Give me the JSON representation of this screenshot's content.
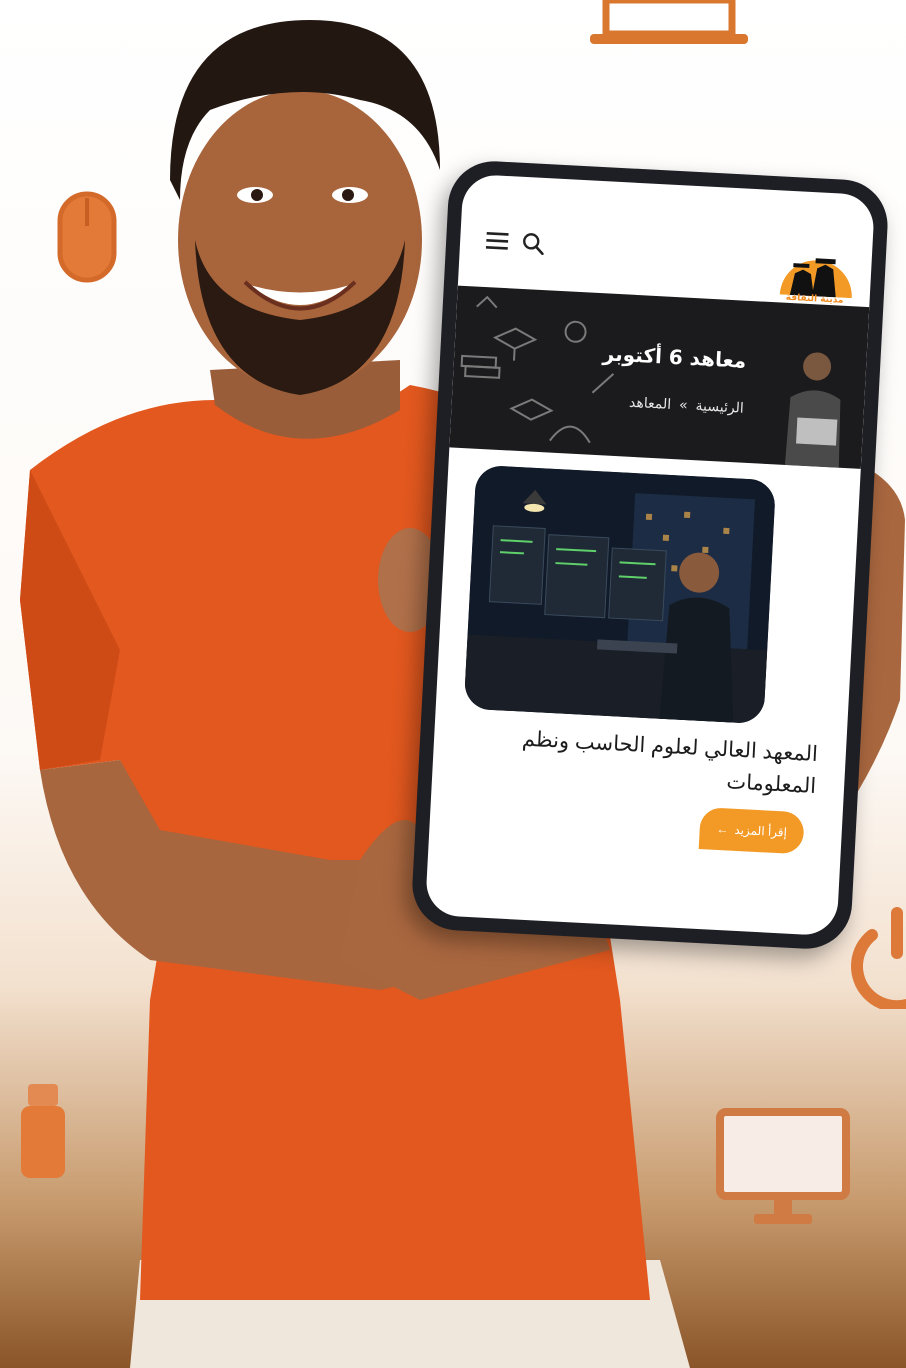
{
  "app": {
    "logo_text": "مدينة الثقافة والعلوم",
    "menu_icon": "hamburger-menu-icon",
    "search_icon": "search-icon"
  },
  "hero": {
    "title": "معاهد 6 أكتوبر",
    "breadcrumb": [
      "الرئيسية",
      "المعاهد"
    ],
    "separator": "»"
  },
  "card": {
    "title": "المعهد العالي لعلوم الحاسب ونظم المعلومات",
    "read_more_label": "إقرأ المزيد",
    "read_more_icon": "arrow-left-icon"
  },
  "colors": {
    "accent": "#f39a26",
    "shirt": "#e2581f",
    "hero_bg": "#1b1b1d"
  }
}
